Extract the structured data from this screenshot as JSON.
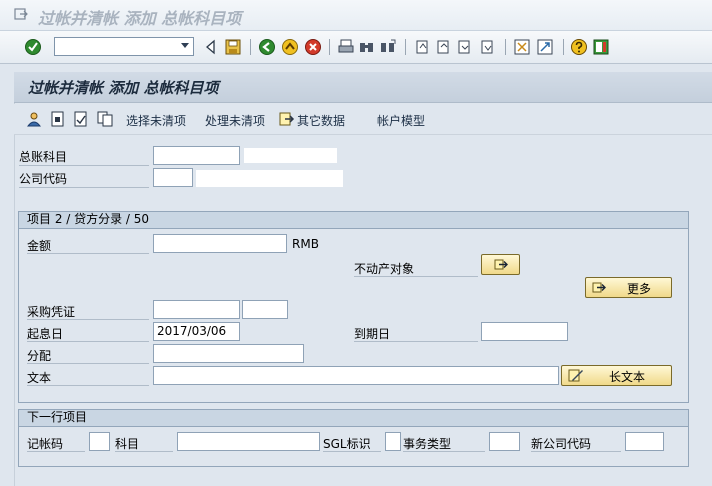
{
  "window": {
    "menu_title": "过帐并清帐 添加 总帐科目项"
  },
  "screen": {
    "title": "过帐并清帐 添加 总帐科目项"
  },
  "app_toolbar": {
    "select_open_items": "选择未清项",
    "process_open_items": "处理未清项",
    "other_data": "其它数据",
    "account_model": "帐户模型"
  },
  "header": {
    "gl_account_label": "总账科目",
    "company_code_label": "公司代码"
  },
  "item_group": {
    "title": "项目 2 / 贷方分录 / 50",
    "amount_label": "金额",
    "currency": "RMB",
    "real_estate_label": "不动产对象",
    "more_button": "更多",
    "purchasing_doc_label": "采购凭证",
    "value_date_label": "起息日",
    "value_date": "2017/03/06",
    "due_date_label": "到期日",
    "assignment_label": "分配",
    "text_label": "文本",
    "long_text_button": "长文本"
  },
  "next_item_group": {
    "title": "下一行项目",
    "posting_key_label": "记帐码",
    "account_label": "科目",
    "sgl_label": "SGL标识",
    "transaction_type_label": "事务类型",
    "new_company_code_label": "新公司代码"
  }
}
